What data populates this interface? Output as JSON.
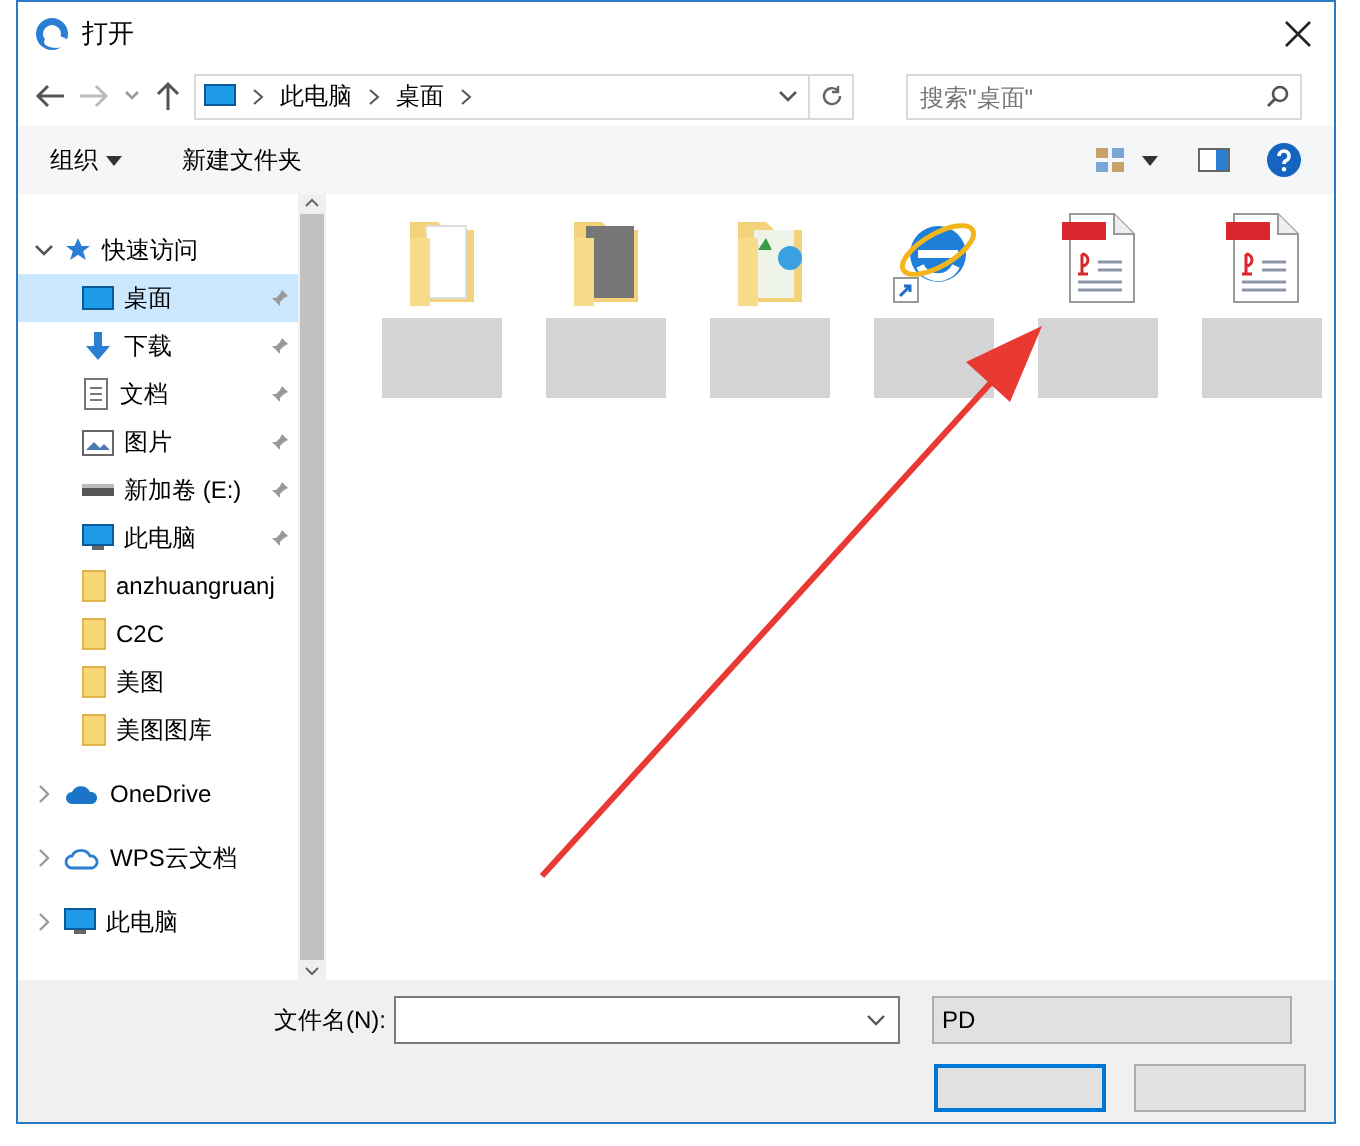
{
  "window": {
    "title": "打开"
  },
  "nav": {
    "path": [
      "此电脑",
      "桌面"
    ],
    "search_placeholder": "搜索\"桌面\""
  },
  "toolbar": {
    "organize": "组织",
    "new_folder": "新建文件夹"
  },
  "sidebar": {
    "items": [
      {
        "label": "快速访问",
        "kind": "star",
        "expanded": true,
        "selected": false,
        "children": [
          {
            "label": "桌面",
            "kind": "desktop",
            "pinned": true,
            "selected": true
          },
          {
            "label": "下载",
            "kind": "download",
            "pinned": true,
            "selected": false
          },
          {
            "label": "文档",
            "kind": "document",
            "pinned": true,
            "selected": false
          },
          {
            "label": "图片",
            "kind": "picture",
            "pinned": true,
            "selected": false
          },
          {
            "label": "新加卷 (E:)",
            "kind": "drive",
            "pinned": true,
            "selected": false
          },
          {
            "label": "此电脑",
            "kind": "computer",
            "pinned": true,
            "selected": false
          },
          {
            "label": "anzhuangruanj",
            "kind": "folder",
            "pinned": false,
            "selected": false
          },
          {
            "label": "C2C",
            "kind": "folder",
            "pinned": false,
            "selected": false
          },
          {
            "label": "美图",
            "kind": "folder",
            "pinned": false,
            "selected": false
          },
          {
            "label": "美图图库",
            "kind": "folder",
            "pinned": false,
            "selected": false
          }
        ]
      },
      {
        "label": "OneDrive",
        "kind": "onedrive",
        "expanded": false,
        "selected": false
      },
      {
        "label": "WPS云文档",
        "kind": "cloud",
        "expanded": false,
        "selected": false
      },
      {
        "label": "此电脑",
        "kind": "computer",
        "expanded": false,
        "selected": false
      }
    ]
  },
  "files": [
    {
      "kind": "folder-doc"
    },
    {
      "kind": "folder-dark"
    },
    {
      "kind": "folder-image"
    },
    {
      "kind": "browser-shortcut"
    },
    {
      "kind": "pdf"
    },
    {
      "kind": "pdf"
    }
  ],
  "bottom": {
    "filename_label": "文件名(N):",
    "file_type": "PD"
  }
}
